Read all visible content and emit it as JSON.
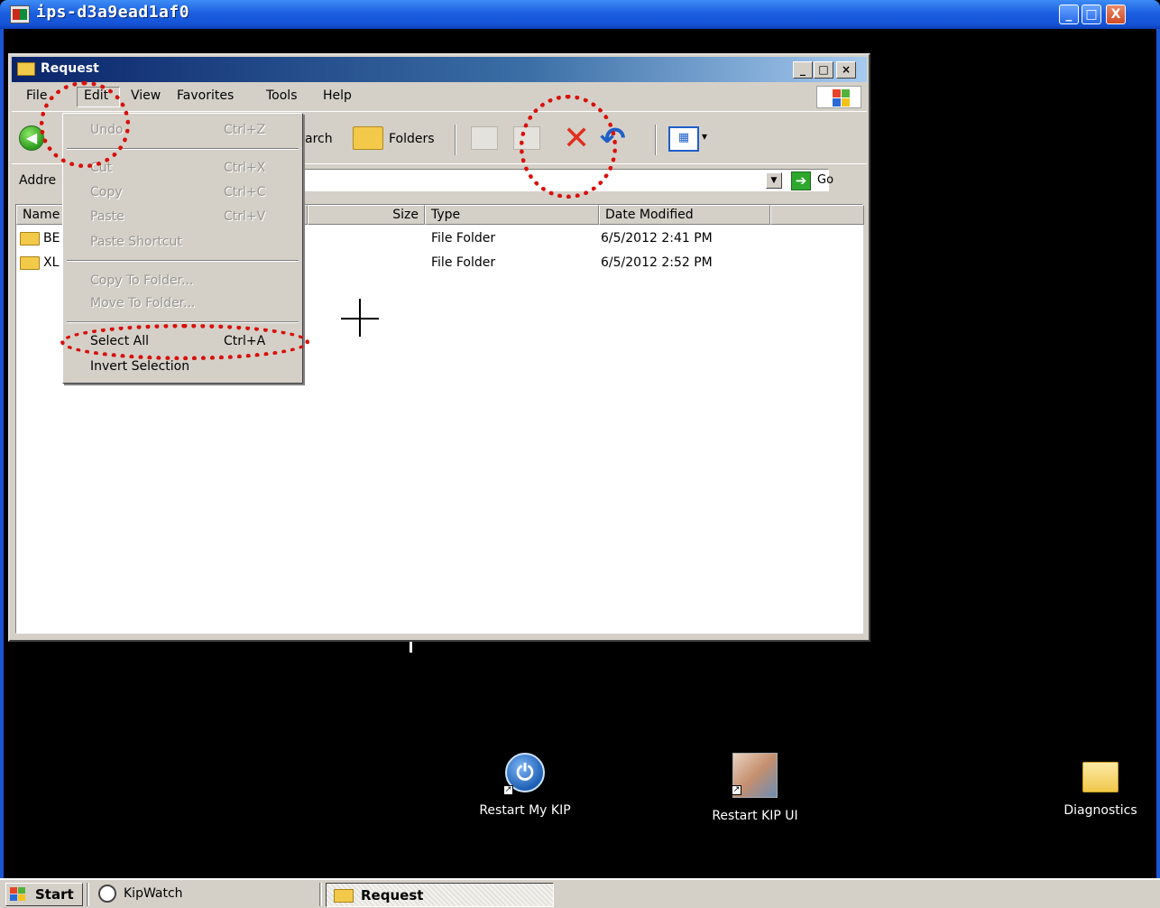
{
  "outer_window": {
    "title": "ips-d3a9ead1af0",
    "buttons": {
      "minimize": "_",
      "maximize": "□",
      "close": "X"
    }
  },
  "explorer": {
    "title": "Request",
    "caption_buttons": {
      "minimize": "_",
      "maximize": "□",
      "close": "×"
    },
    "menu": [
      "File",
      "Edit",
      "View",
      "Favorites",
      "Tools",
      "Help"
    ],
    "toolbar": {
      "back_label": "B",
      "search_label": "arch",
      "folders_label": "Folders",
      "views_glyph": "▦"
    },
    "address": {
      "label": "Addre",
      "go_label": "Go",
      "go_glyph": "➔"
    },
    "columns": [
      "Name",
      "Size",
      "Type",
      "Date Modified"
    ],
    "rows": [
      {
        "name": "BE",
        "type": "File Folder",
        "date_modified": "6/5/2012 2:41 PM"
      },
      {
        "name": "XL",
        "type": "File Folder",
        "date_modified": "6/5/2012 2:52 PM"
      }
    ]
  },
  "edit_menu": {
    "items": [
      {
        "label": "Undo",
        "shortcut": "Ctrl+Z",
        "enabled": false
      },
      {
        "label": "Cut",
        "shortcut": "Ctrl+X",
        "enabled": false
      },
      {
        "label": "Copy",
        "shortcut": "Ctrl+C",
        "enabled": false
      },
      {
        "label": "Paste",
        "shortcut": "Ctrl+V",
        "enabled": false
      },
      {
        "label": "Paste Shortcut",
        "shortcut": "",
        "enabled": false
      },
      {
        "label": "Copy To Folder...",
        "shortcut": "",
        "enabled": false
      },
      {
        "label": "Move To Folder...",
        "shortcut": "",
        "enabled": false
      },
      {
        "label": "Select All",
        "shortcut": "Ctrl+A",
        "enabled": true
      },
      {
        "label": "Invert Selection",
        "shortcut": "",
        "enabled": true
      }
    ]
  },
  "desktop_icons": [
    {
      "label": "Restart My KIP",
      "icon": "power-icon"
    },
    {
      "label": "Restart KIP UI",
      "icon": "hand-touch-icon"
    },
    {
      "label": "Diagnostics",
      "icon": "folder-icon"
    }
  ],
  "taskbar": {
    "start_label": "Start",
    "tasks": [
      {
        "label": "KipWatch",
        "icon": "clock-icon",
        "active": false
      },
      {
        "label": "Request",
        "icon": "folder-icon",
        "active": true
      }
    ]
  },
  "annotation_color": "#d8100c"
}
